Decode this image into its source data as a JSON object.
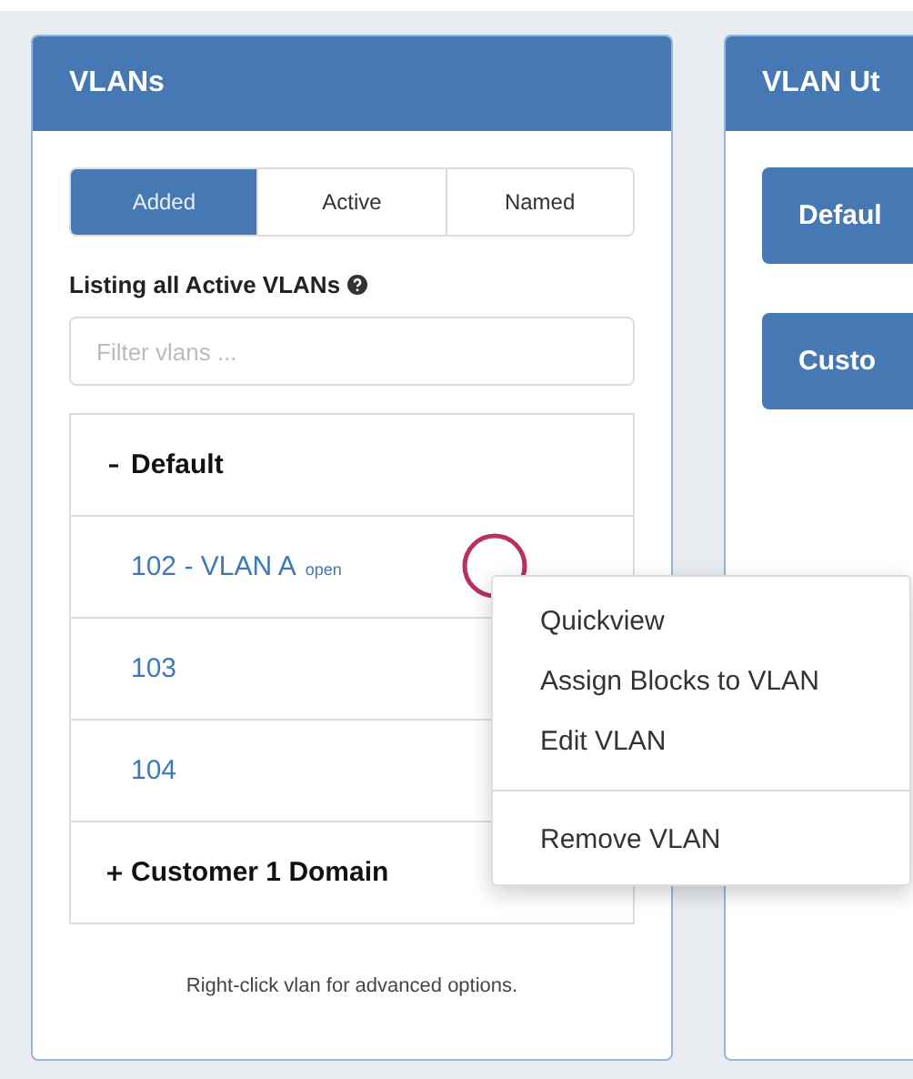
{
  "vlans_panel": {
    "title": "VLANs",
    "tabs": [
      {
        "label": "Added",
        "selected": true
      },
      {
        "label": "Active",
        "selected": false
      },
      {
        "label": "Named",
        "selected": false
      }
    ],
    "listing_label": "Listing all Active VLANs",
    "filter": {
      "placeholder": "Filter vlans ..."
    },
    "tree": [
      {
        "label": "Default",
        "expanded": true,
        "children": [
          {
            "label": "102 - VLAN A",
            "tag": "open"
          },
          {
            "label": "103"
          },
          {
            "label": "104"
          }
        ]
      },
      {
        "label": "Customer 1 Domain",
        "expanded": false
      }
    ],
    "hint": "Right-click vlan for advanced options."
  },
  "utilities_panel": {
    "title": "VLAN Ut",
    "buttons": [
      "Defaul",
      "Custo"
    ]
  },
  "context_menu": {
    "sections": [
      [
        "Quickview",
        "Assign Blocks to VLAN",
        "Edit VLAN"
      ],
      [
        "Remove VLAN"
      ]
    ]
  }
}
